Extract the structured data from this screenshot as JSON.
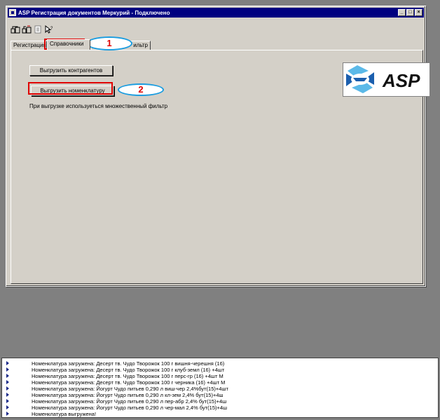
{
  "window": {
    "title": "ASP Регистрация документов Меркурий - Подключено",
    "controls": [
      "_",
      "□",
      "×"
    ]
  },
  "tabs": [
    {
      "label": "Регистрация",
      "active": false
    },
    {
      "label": "Справочники",
      "active": true
    },
    {
      "label": "Фильтр",
      "active": false
    }
  ],
  "tab_partial_label": "ильтр",
  "buttons": {
    "export_contractors": "Выгрузить контрагентов",
    "export_nomenclature": "Выгрузить номенклатуру"
  },
  "filter_note": "При выгрузке используеться множественный фильтр",
  "annotations": {
    "marker1": "1",
    "marker2": "2",
    "highlight_color": "#e00000",
    "ellipse_color": "#1c9de0"
  },
  "logo": {
    "text": "ASP",
    "colors": [
      "#1b5fae",
      "#5bb9e8",
      "#111111"
    ]
  },
  "log": [
    "Номенклатура загружена: Десерт тв. Чудо Творожок 100 г вишня-черешня (16)",
    "Номенклатура загружена: Десерт тв. Чудо Творожок 100 г клуб-земл (16) +4шт",
    "Номенклатура загружена: Десерт тв. Чудо Творожок 100 г перс-гр (16) +4шт М",
    "Номенклатура загружена: Десерт тв. Чудо Творожок 100 г черника (16) +4шт М",
    "Номенклатура загружена: Йогурт Чудо питьев 0,290 л виш-чер 2,4%бут(15)+4шт",
    "Номенклатура загружена: Йогурт Чудо питьев 0,290 л кл-зем 2,4% бут(15)+4ш",
    "Номенклатура загружена: Йогурт Чудо питьев 0,290 л пер-абр 2,4% бут(15)+4ш",
    "Номенклатура загружена: Йогурт Чудо питьев 0,290 л чер-мал 2,4% бут(15)+4ш",
    "Номенклатура выгружена!"
  ]
}
